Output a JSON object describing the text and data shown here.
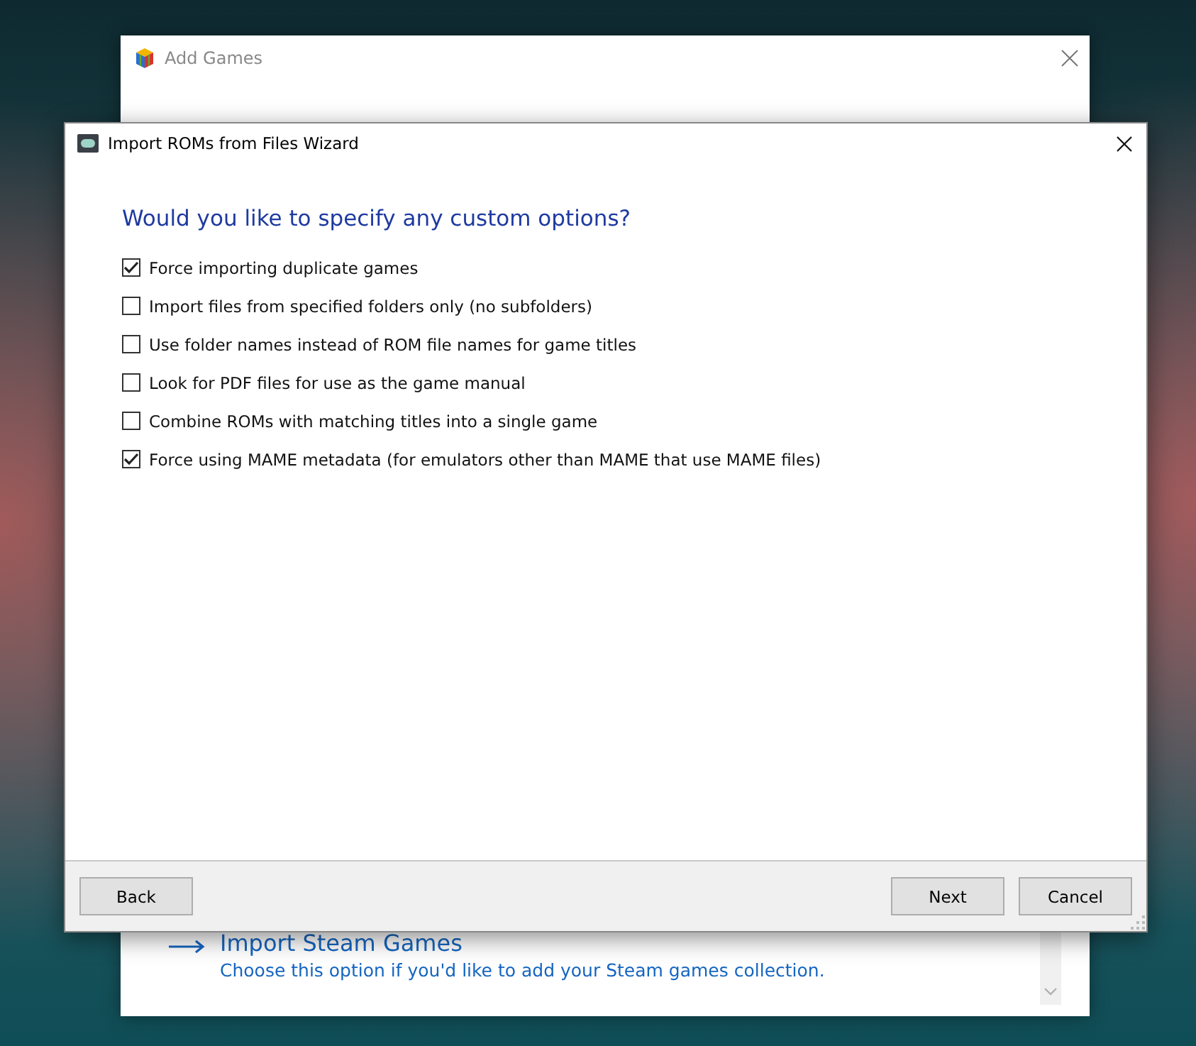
{
  "back_window": {
    "title": "Add Games",
    "options": [
      {
        "title": "Import Steam Games",
        "description": "Choose this option if you'd like to add your Steam games collection."
      }
    ]
  },
  "wizard": {
    "title": "Import ROMs from Files Wizard",
    "heading": "Would you like to specify any custom options?",
    "options": [
      {
        "label": "Force importing duplicate games",
        "checked": true
      },
      {
        "label": "Import files from specified folders only (no subfolders)",
        "checked": false
      },
      {
        "label": "Use folder names instead of ROM file names for game titles",
        "checked": false
      },
      {
        "label": "Look for PDF files for use as the game manual",
        "checked": false
      },
      {
        "label": "Combine ROMs with matching titles into a single game",
        "checked": false
      },
      {
        "label": "Force using MAME metadata (for emulators other than MAME that use MAME files)",
        "checked": true
      }
    ],
    "buttons_left": [
      "Back"
    ],
    "buttons_right": [
      "Next",
      "Cancel"
    ]
  }
}
